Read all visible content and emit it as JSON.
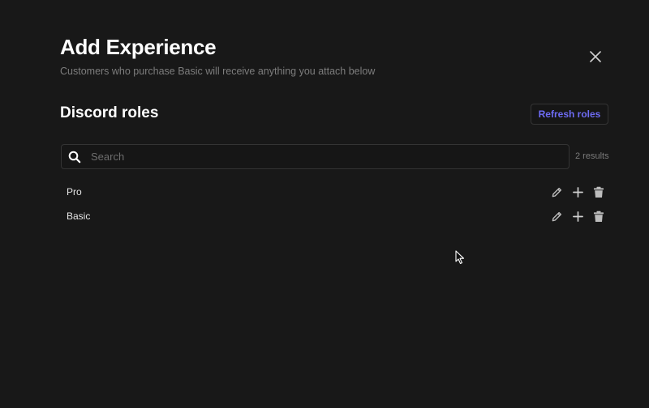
{
  "modal": {
    "title": "Add Experience",
    "subtitle": "Customers who purchase Basic will receive anything you attach below",
    "close_icon": "close-icon"
  },
  "discord": {
    "section_title": "Discord roles",
    "refresh_label": "Refresh roles",
    "accent_color": "#6e6cf5"
  },
  "search": {
    "placeholder": "Search",
    "value": "",
    "results_label": "2 results"
  },
  "roles": [
    {
      "name": "Pro",
      "actions": [
        "pencil-icon",
        "plus-icon",
        "trash-icon"
      ]
    },
    {
      "name": "Basic",
      "actions": [
        "pencil-icon",
        "plus-icon",
        "trash-icon"
      ]
    }
  ]
}
